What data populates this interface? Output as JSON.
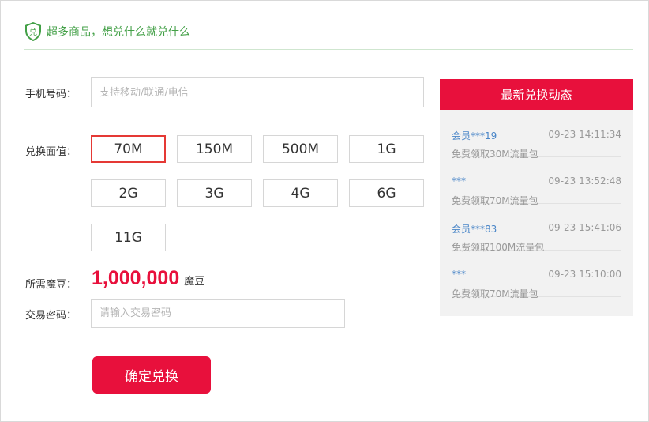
{
  "header": {
    "icon_char": "兑",
    "title": "超多商品，想兑什么就兑什么",
    "accent_color": "#43a047"
  },
  "form": {
    "phone": {
      "label": "手机号码：",
      "placeholder": "支持移动/联通/电信",
      "value": ""
    },
    "denomination": {
      "label": "兑换面值：",
      "selected": "70M",
      "options": [
        "70M",
        "150M",
        "500M",
        "1G",
        "2G",
        "3G",
        "4G",
        "6G",
        "11G"
      ]
    },
    "cost": {
      "label": "所需魔豆：",
      "amount": "1,000,000",
      "unit": "魔豆"
    },
    "password": {
      "label": "交易密码：",
      "placeholder": "请输入交易密码",
      "value": ""
    },
    "confirm_label": "确定兑换"
  },
  "feed": {
    "title": "最新兑换动态",
    "items": [
      {
        "user": "会员***19",
        "time": "09-23 14:11:34",
        "desc": "免费领取30M流量包"
      },
      {
        "user": "***",
        "time": "09-23 13:52:48",
        "desc": "免费领取70M流量包"
      },
      {
        "user": "会员***83",
        "time": "09-23 15:41:06",
        "desc": "免费领取100M流量包"
      },
      {
        "user": "***",
        "time": "09-23 15:10:00",
        "desc": "免费领取70M流量包"
      }
    ]
  },
  "colors": {
    "brand_red": "#e8103c",
    "link_blue": "#4a86c8"
  }
}
